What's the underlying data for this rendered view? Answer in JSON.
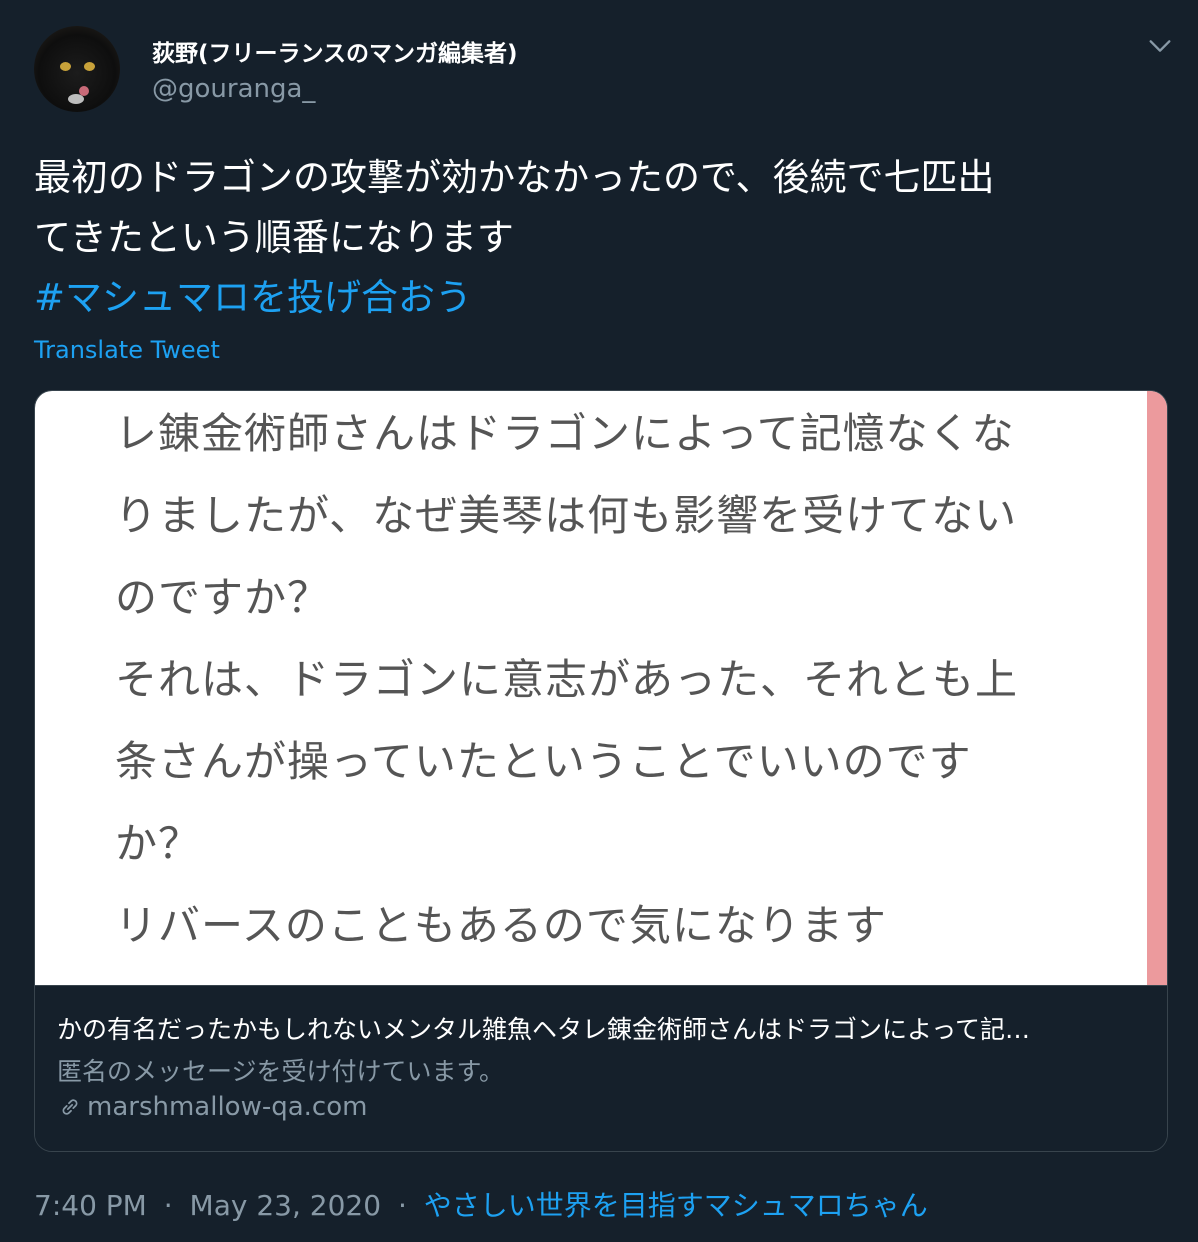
{
  "user": {
    "name": "荻野(フリーランスのマンガ編集者)",
    "handle": "@gouranga_"
  },
  "tweet": {
    "text_line1": "最初のドラゴンの攻撃が効かなかったので、後続で七匹出",
    "text_line2": "てきたという順番になります",
    "hashtag": "#マシュマロを投げ合おう",
    "translate_label": "Translate Tweet"
  },
  "card": {
    "image_lines": [
      "レ錬金術師さんはドラゴンによって記憶なくな",
      "りましたが、なぜ美琴は何も影響を受けてない",
      "のですか？",
      "それは、ドラゴンに意志があった、それとも上",
      "条さんが操っていたということでいいのです",
      "か？",
      "リバースのこともあるので気になります"
    ],
    "title": "かの有名だったかもしれないメンタル雑魚ヘタレ錬金術師さんはドラゴンによって記…",
    "description": "匿名のメッセージを受け付けています。",
    "domain": "marshmallow-qa.com",
    "accent_color": "#ec9a9d"
  },
  "footer": {
    "time": "7:40 PM",
    "date": "May 23, 2020",
    "separator": "·",
    "source": "やさしい世界を目指すマシュマロちゃん"
  },
  "colors": {
    "background": "#15202b",
    "link": "#1da1f2",
    "secondary": "#8899a6"
  },
  "icons": [
    "avatar",
    "chevron-down-icon",
    "link-icon"
  ]
}
